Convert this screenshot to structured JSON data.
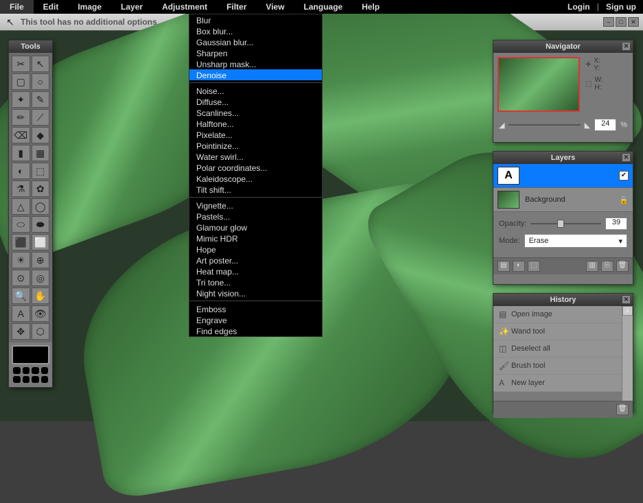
{
  "menu": [
    "File",
    "Edit",
    "Image",
    "Layer",
    "Adjustment",
    "Filter",
    "View",
    "Language",
    "Help"
  ],
  "auth": {
    "login": "Login",
    "signup": "Sign up"
  },
  "toolbar": {
    "msg": "This tool has no additional options"
  },
  "tools_title": "Tools",
  "filter_menu": {
    "groups": [
      [
        "Blur",
        "Box blur...",
        "Gaussian blur...",
        "Sharpen",
        "Unsharp mask...",
        "Denoise"
      ],
      [
        "Noise...",
        "Diffuse...",
        "Scanlines...",
        "Halftone...",
        "Pixelate...",
        "Pointinize...",
        "Water swirl...",
        "Polar coordinates...",
        "Kaleidoscope...",
        "Tilt shift..."
      ],
      [
        "Vignette...",
        "Pastels...",
        "Glamour glow",
        "Mimic HDR",
        "Hope",
        "Art poster...",
        "Heat map...",
        "Tri tone...",
        "Night vision..."
      ],
      [
        "Emboss",
        "Engrave",
        "Find edges"
      ]
    ],
    "selected": "Denoise"
  },
  "navigator": {
    "title": "Navigator",
    "x": "X:",
    "y": "Y:",
    "w": "W:",
    "h": "H:",
    "zoom": "24",
    "pct": "%"
  },
  "layers": {
    "title": "Layers",
    "rows": [
      {
        "name": "A",
        "label": "",
        "selected": true,
        "thumb": "A"
      },
      {
        "name": "bg",
        "label": "Background",
        "selected": false,
        "thumb": "img",
        "locked": true
      }
    ],
    "opacity_label": "Opacity:",
    "opacity": "39",
    "mode_label": "Mode:",
    "mode": "Erase"
  },
  "history": {
    "title": "History",
    "items": [
      {
        "icon": "▤",
        "label": "Open image"
      },
      {
        "icon": "✨",
        "label": "Wand tool"
      },
      {
        "icon": "◫",
        "label": "Deselect all"
      },
      {
        "icon": "🖌",
        "label": "Brush tool"
      },
      {
        "icon": "A",
        "label": "New layer"
      }
    ]
  },
  "tool_icons": [
    "✂",
    "↖",
    "▢",
    "○",
    "✦",
    "✎",
    "✏",
    "⟋",
    "⌫",
    "◆",
    "▮",
    "▦",
    "◐",
    "⬚",
    "⚗",
    "✿",
    "△",
    "◯",
    "⬭",
    "⬬",
    "⬛",
    "⬜",
    "☀",
    "⊕",
    "⊙",
    "◎",
    "🔍",
    "✋",
    "A",
    "👁",
    "✥",
    "⬡"
  ]
}
